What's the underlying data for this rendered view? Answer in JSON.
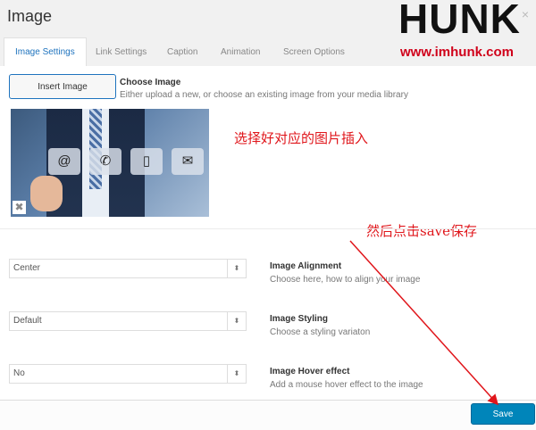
{
  "modal": {
    "title": "Image",
    "close_glyph": "×"
  },
  "logo": {
    "brand": "HUNK",
    "url": "www.imhunk.com"
  },
  "tabs": [
    {
      "label": "Image Settings",
      "active": true
    },
    {
      "label": "Link Settings",
      "active": false
    },
    {
      "label": "Caption",
      "active": false
    },
    {
      "label": "Animation",
      "active": false
    },
    {
      "label": "Screen Options",
      "active": false
    }
  ],
  "image": {
    "insert_label": "Insert Image",
    "choose_title": "Choose Image",
    "choose_desc": "Either upload a new, or choose an existing image from your media library",
    "preview_icons": [
      "@",
      "✆",
      "▯",
      "✉"
    ],
    "remove_glyph": "✖"
  },
  "annotations": {
    "select_note": "选择好对应的图片插入",
    "save_note": "然后点击save保存",
    "color": "#e0161b"
  },
  "options": [
    {
      "value": "Center",
      "title": "Image Alignment",
      "desc": "Choose here, how to align your image"
    },
    {
      "value": "Default",
      "title": "Image Styling",
      "desc": "Choose a styling variaton"
    },
    {
      "value": "No",
      "title": "Image Hover effect",
      "desc": "Add a mouse hover effect to the image"
    }
  ],
  "select_arrow": "⬍",
  "footer": {
    "save_label": "Save"
  },
  "colors": {
    "accent": "#0085ba",
    "tab_active": "#1e73be"
  }
}
